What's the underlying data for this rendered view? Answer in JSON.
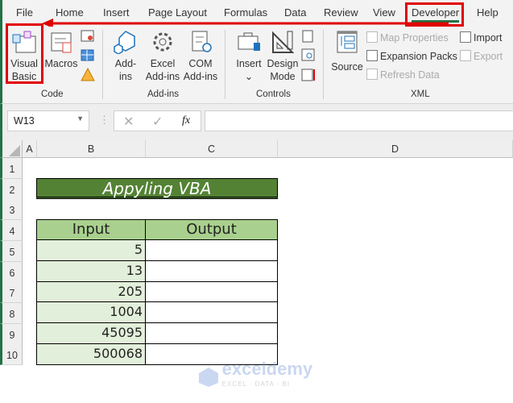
{
  "tabs": [
    "File",
    "Home",
    "Insert",
    "Page Layout",
    "Formulas",
    "Data",
    "Review",
    "View",
    "Developer",
    "Help"
  ],
  "active_tab": "Developer",
  "ribbon": {
    "code": {
      "visual_basic": [
        "Visual",
        "Basic"
      ],
      "macros": "Macros",
      "group": "Code"
    },
    "addins": {
      "addins": [
        "Add-",
        "ins"
      ],
      "excel_addins": [
        "Excel",
        "Add-ins"
      ],
      "com_addins": [
        "COM",
        "Add-ins"
      ],
      "group": "Add-ins"
    },
    "controls": {
      "insert": "Insert",
      "design_mode": [
        "Design",
        "Mode"
      ],
      "group": "Controls"
    },
    "xml": {
      "source": "Source",
      "map_properties": "Map Properties",
      "expansion_packs": "Expansion Packs",
      "refresh_data": "Refresh Data",
      "import": "Import",
      "export": "Export",
      "group": "XML"
    }
  },
  "name_box": "W13",
  "fx": "fx",
  "columns": [
    "A",
    "B",
    "C",
    "D"
  ],
  "rows": [
    "1",
    "2",
    "3",
    "4",
    "5",
    "6",
    "7",
    "8",
    "9",
    "10"
  ],
  "sheet": {
    "title": "Appyling VBA",
    "headers": [
      "Input",
      "Output"
    ],
    "inputs": [
      "5",
      "13",
      "205",
      "1004",
      "45095",
      "500068"
    ]
  },
  "watermark": {
    "name": "exceldemy",
    "tagline": "EXCEL · DATA · BI"
  },
  "colors": {
    "accent": "#217346",
    "title_bg": "#548235",
    "header_bg": "#a9d08e",
    "input_bg": "#e2efda",
    "highlight": "#e00000"
  }
}
